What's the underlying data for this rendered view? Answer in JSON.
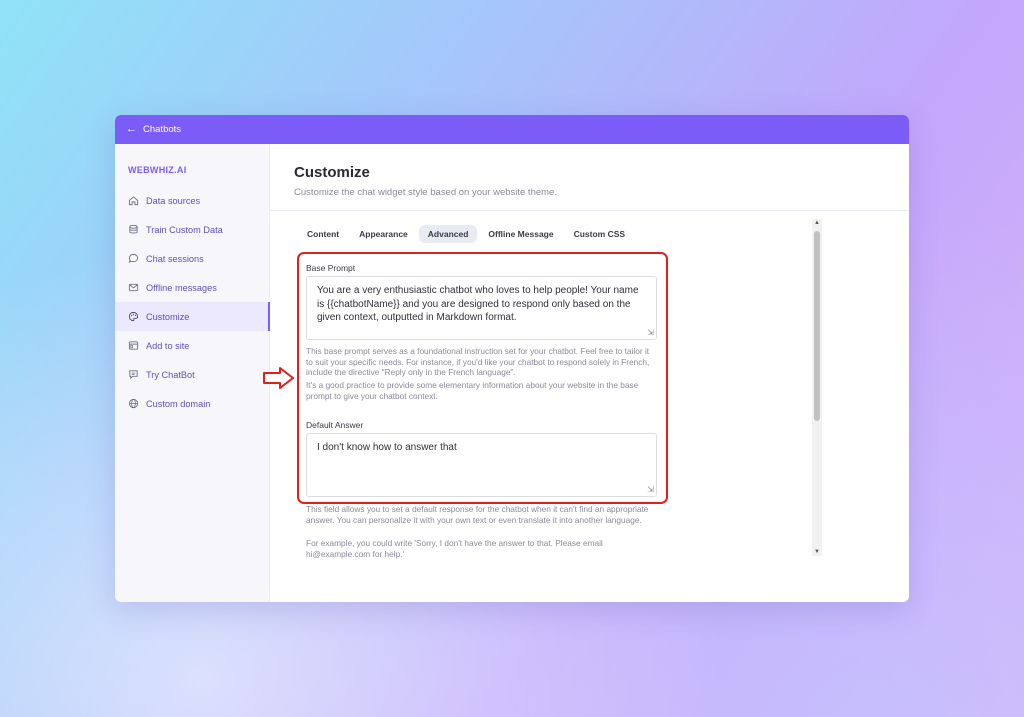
{
  "header": {
    "back_label": "Chatbots"
  },
  "sidebar": {
    "brand": "WEBWHIZ.AI",
    "items": [
      {
        "label": "Data sources",
        "icon": "home-icon"
      },
      {
        "label": "Train Custom Data",
        "icon": "database-icon"
      },
      {
        "label": "Chat sessions",
        "icon": "chat-bubble-icon"
      },
      {
        "label": "Offline messages",
        "icon": "mail-icon"
      },
      {
        "label": "Customize",
        "icon": "palette-icon",
        "active": true
      },
      {
        "label": "Add to site",
        "icon": "browser-icon"
      },
      {
        "label": "Try ChatBot",
        "icon": "message-square-icon"
      },
      {
        "label": "Custom domain",
        "icon": "globe-icon"
      }
    ]
  },
  "main": {
    "title": "Customize",
    "subtitle": "Customize the chat widget style based on your website theme.",
    "tabs": [
      "Content",
      "Appearance",
      "Advanced",
      "Offline Message",
      "Custom CSS"
    ],
    "active_tab": "Advanced",
    "base_prompt": {
      "label": "Base Prompt",
      "value": "You are a very enthusiastic chatbot who loves to help people! Your name is {{chatbotName}} and you are designed to respond only based on the given context, outputted in Markdown format.",
      "help_1": "This base prompt serves as a foundational instruction set for your chatbot. Feel free to tailor it to suit your specific needs. For instance, if you'd like your chatbot to respond solely in French, include the directive \"Reply only in the French language\".",
      "help_2": "It's a good practice to provide some elementary information about your website in the base prompt to give your chatbot context."
    },
    "default_answer": {
      "label": "Default Answer",
      "value": "I don't know how to answer that",
      "help_1": "This field allows you to set a default response for the chatbot when it can't find an appropriate answer. You can personalize it with your own text or even translate it into another language.",
      "help_2": "For example, you could write 'Sorry, I don't have the answer to that. Please email hi@example.com for help.'"
    }
  },
  "colors": {
    "accent": "#7b5cf6",
    "highlight": "#e0201e"
  }
}
